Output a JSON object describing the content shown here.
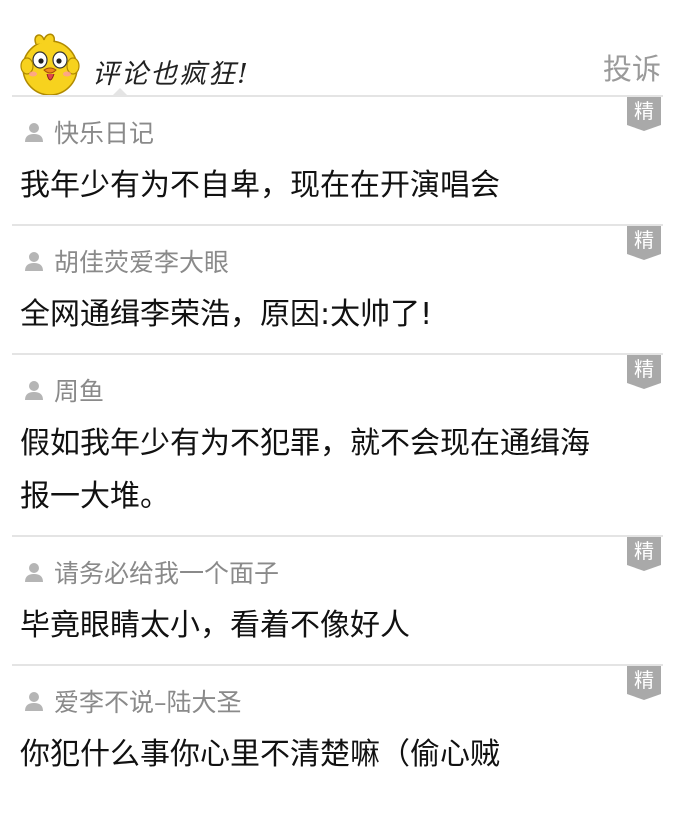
{
  "header": {
    "title": "评论也疯狂!",
    "report_label": "投诉",
    "mascot_icon": "chick-mascot-icon"
  },
  "badge_label": "精",
  "colors": {
    "badge_bg": "#a9a9a9",
    "username": "#8a8a8a",
    "text": "#111111",
    "separator": "#e4e4e4"
  },
  "comments": [
    {
      "user": "快乐日记",
      "text": "我年少有为不自卑，现在在开演唱会"
    },
    {
      "user": "胡佳荧爱李大眼",
      "text": "全网通缉李荣浩，原因:太帅了!"
    },
    {
      "user": "周鱼",
      "text": "假如我年少有为不犯罪，就不会现在通缉海报一大堆。"
    },
    {
      "user": "请务必给我一个面子",
      "text": "毕竟眼睛太小，看着不像好人"
    },
    {
      "user": "爱李不说–陆大圣",
      "text": "你犯什么事你心里不清楚嘛（偷心贼"
    }
  ]
}
